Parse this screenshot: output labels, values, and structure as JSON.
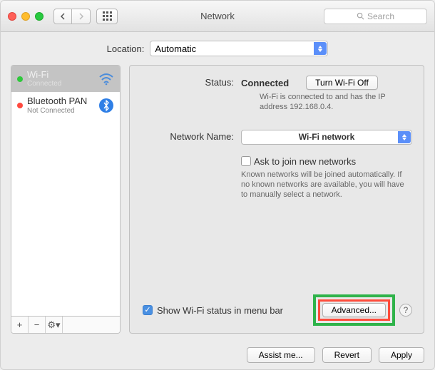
{
  "window": {
    "title": "Network"
  },
  "search": {
    "placeholder": "Search"
  },
  "location": {
    "label": "Location:",
    "value": "Automatic"
  },
  "services": [
    {
      "name": "Wi-Fi",
      "status": "Connected",
      "dot": "green",
      "selected": true,
      "icon": "wifi"
    },
    {
      "name": "Bluetooth PAN",
      "status": "Not Connected",
      "dot": "red",
      "selected": false,
      "icon": "bluetooth"
    }
  ],
  "sidebar_buttons": {
    "add": "+",
    "remove": "−",
    "gear": "⚙︎▾"
  },
  "detail": {
    "status_label": "Status:",
    "status_value": "Connected",
    "toggle_label": "Turn Wi-Fi Off",
    "status_desc": "Wi-Fi is connected to   and has the IP address 192.168.0.4.",
    "network_name_label": "Network Name:",
    "network_name_value": "Wi-Fi network",
    "ask_label": "Ask to join new networks",
    "ask_desc": "Known networks will be joined automatically. If no known networks are available, you will have to manually select a network.",
    "menu_bar_label": "Show Wi-Fi status in menu bar",
    "advanced_label": "Advanced...",
    "help": "?"
  },
  "footer": {
    "assist": "Assist me...",
    "revert": "Revert",
    "apply": "Apply"
  }
}
